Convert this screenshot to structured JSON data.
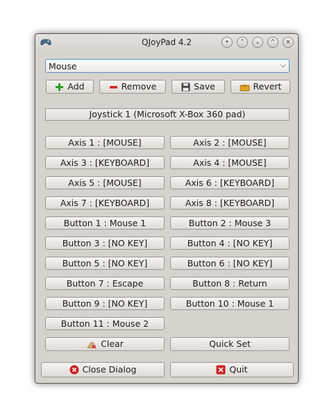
{
  "window": {
    "title": "QJoyPad 4.2",
    "controls": [
      "minimize",
      "keep-above",
      "keep-below",
      "maximize",
      "close"
    ]
  },
  "layout_select": {
    "value": "Mouse"
  },
  "toolbar": {
    "add": "Add",
    "remove": "Remove",
    "save": "Save",
    "revert": "Revert"
  },
  "joystick_label": "Joystick 1 (Microsoft X-Box 360 pad)",
  "mappings": [
    [
      "Axis 1 : [MOUSE]",
      "Axis 2 : [MOUSE]"
    ],
    [
      "Axis 3 : [KEYBOARD]",
      "Axis 4 : [MOUSE]"
    ],
    [
      "Axis 5 : [MOUSE]",
      "Axis 6 : [KEYBOARD]"
    ],
    [
      "Axis 7 : [KEYBOARD]",
      "Axis 8 : [KEYBOARD]"
    ],
    [
      "Button 1 : Mouse 1",
      "Button 2 : Mouse 3"
    ],
    [
      "Button 3 : [NO KEY]",
      "Button 4 : [NO KEY]"
    ],
    [
      "Button 5 : [NO KEY]",
      "Button 6 : [NO KEY]"
    ],
    [
      "Button 7 : Escape",
      "Button 8 : Return"
    ],
    [
      "Button 9 : [NO KEY]",
      "Button 10 : Mouse 1"
    ],
    [
      "Button 11 : Mouse 2"
    ]
  ],
  "actions": {
    "clear": "Clear",
    "quick_set": "Quick Set",
    "close_dialog": "Close Dialog",
    "quit": "Quit"
  },
  "icons": {
    "add": "plus-icon",
    "remove": "minus-icon",
    "save": "floppy-disk-icon",
    "revert": "revert-icon",
    "clear": "eraser-icon",
    "close_dialog": "close-circle-icon",
    "quit": "quit-icon"
  },
  "colors": {
    "add_icon": "#2e9d24",
    "remove_icon": "#d42020",
    "close_icon": "#cc2121",
    "focus_border": "#5f8fc0"
  }
}
